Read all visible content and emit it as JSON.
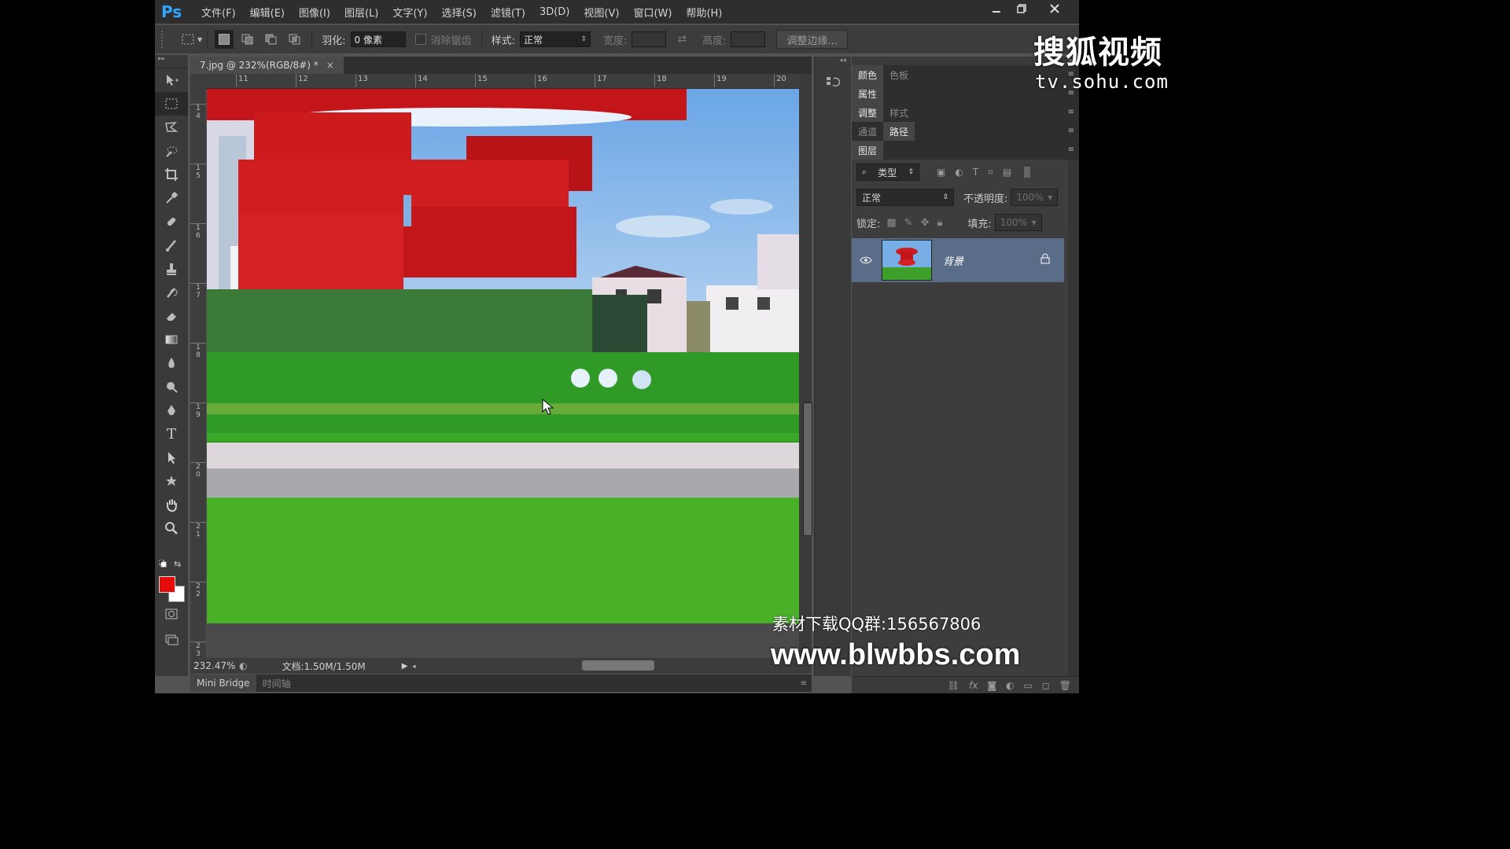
{
  "app": {
    "logo": "Ps",
    "menu": [
      "文件(F)",
      "编辑(E)",
      "图像(I)",
      "图层(L)",
      "文字(Y)",
      "选择(S)",
      "滤镜(T)",
      "3D(D)",
      "视图(V)",
      "窗口(W)",
      "帮助(H)"
    ]
  },
  "options": {
    "feather_label": "羽化:",
    "feather_value": "0 像素",
    "antialias_label": "消除锯齿",
    "style_label": "样式:",
    "style_value": "正常",
    "width_label": "宽度:",
    "height_label": "高度:",
    "refine_edge": "调整边缘..."
  },
  "document": {
    "tab_title": "7.jpg @ 232%(RGB/8#) *",
    "ruler_h": [
      "11",
      "12",
      "13",
      "14",
      "15",
      "16",
      "17",
      "18",
      "19",
      "20"
    ],
    "ruler_v": [
      "1\n4",
      "1\n5",
      "1\n6",
      "1\n7",
      "1\n8",
      "1\n9",
      "2\n0",
      "2\n1",
      "2\n2",
      "2\n3"
    ]
  },
  "status": {
    "zoom": "232.47%",
    "doc_info": "文档:1.50M/1.50M"
  },
  "bottom_tabs": [
    "Mini Bridge",
    "时间轴"
  ],
  "panels": {
    "row1": [
      "颜色",
      "色板"
    ],
    "row2": [
      "属性"
    ],
    "row3": [
      "调整",
      "样式"
    ],
    "row4": [
      "通道",
      "路径"
    ],
    "row5": [
      "图层"
    ],
    "filter_kind": "类型",
    "blend_mode": "正常",
    "opacity_label": "不透明度:",
    "opacity_value": "100%",
    "lock_label": "锁定:",
    "fill_label": "填充:",
    "fill_value": "100%",
    "layer_name": "背景"
  },
  "watermarks": {
    "sohu": "搜狐视频",
    "sohu_url": "tv.sohu.com",
    "qq": "素材下载QQ群:156567806",
    "site": "www.blwbbs.com"
  },
  "colors": {
    "foreground": "#e50b0b",
    "background": "#ffffff",
    "accent": "#31a8ff",
    "selected_layer": "#596c88"
  }
}
